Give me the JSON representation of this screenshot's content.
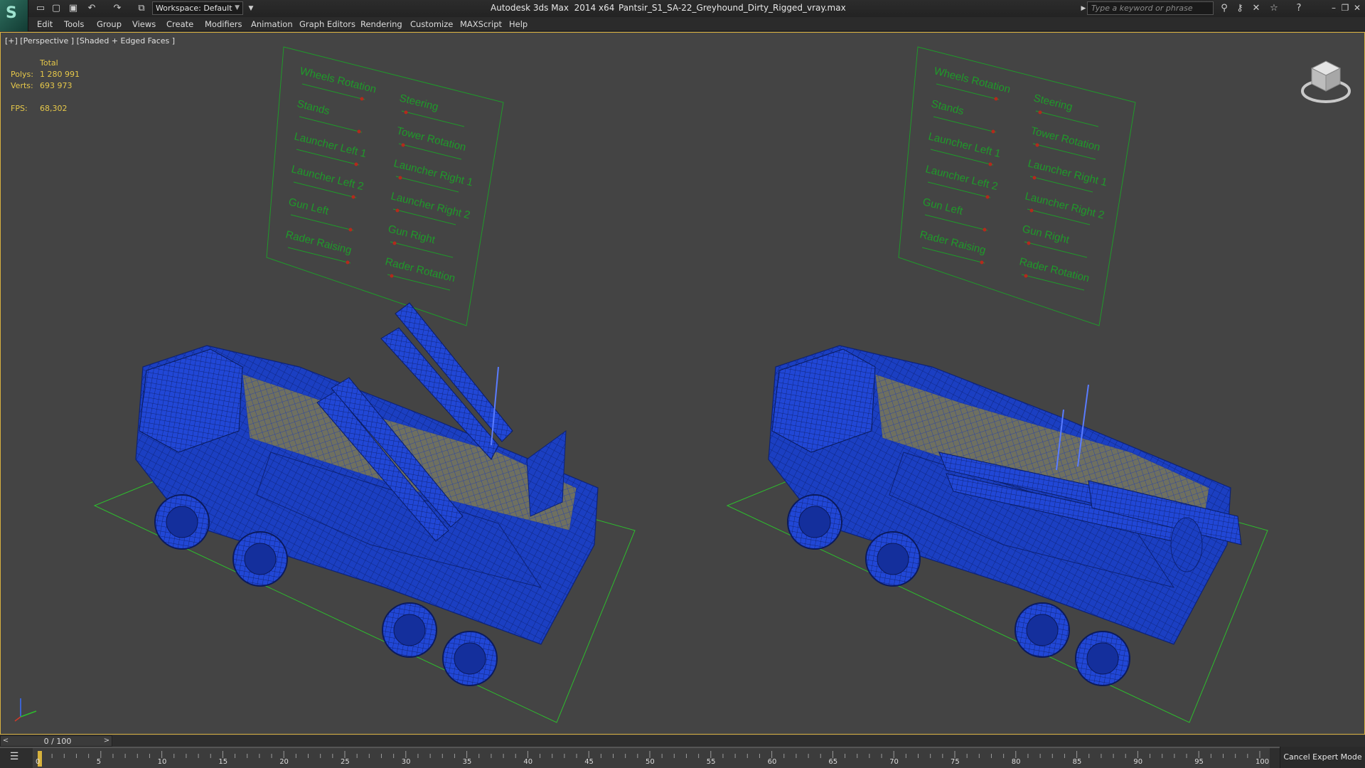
{
  "titlebar": {
    "app_title": "Autodesk 3ds Max  2014 x64",
    "file_name": "Pantsir_S1_SA-22_Greyhound_Dirty_Rigged_vray.max",
    "workspace_label": "Workspace: Default",
    "search_placeholder": "Type a keyword or phrase",
    "quick_access_icons": [
      "new-file-icon",
      "open-file-icon",
      "save-icon",
      "undo-icon",
      "redo-icon",
      "project-folder-icon"
    ],
    "help_icons": [
      "binoculars-icon",
      "key-icon",
      "tools-icon",
      "favorites-star-icon",
      "help-icon"
    ]
  },
  "menu": {
    "items": [
      {
        "label": "Edit"
      },
      {
        "label": "Tools"
      },
      {
        "label": "Group"
      },
      {
        "label": "Views"
      },
      {
        "label": "Create"
      },
      {
        "label": "Modifiers"
      },
      {
        "label": "Animation"
      },
      {
        "label": "Graph Editors"
      },
      {
        "label": "Rendering"
      },
      {
        "label": "Customize"
      },
      {
        "label": "MAXScript"
      },
      {
        "label": "Help"
      }
    ]
  },
  "viewport": {
    "label": "[+] [Perspective ] [Shaded + Edged Faces ]",
    "stats": {
      "header": "Total",
      "polys_label": "Polys:",
      "polys_value": "1 280 991",
      "verts_label": "Verts:",
      "verts_value": "693 973",
      "fps_label": "FPS:",
      "fps_value": "68,302"
    },
    "control_panels": [
      {
        "left_column": [
          "Wheels Rotation",
          "Stands",
          "Launcher Left 1",
          "Launcher Left 2",
          "Gun Left",
          "Rader Raising"
        ],
        "right_column": [
          "Steering",
          "Tower Rotation",
          "Launcher Right 1",
          "Launcher Right 2",
          "Gun Right",
          "Rader Rotation"
        ]
      },
      {
        "left_column": [
          "Wheels Rotation",
          "Stands",
          "Launcher Left 1",
          "Launcher Left 2",
          "Gun Left",
          "Rader Raising"
        ],
        "right_column": [
          "Steering",
          "Tower Rotation",
          "Launcher Right 1",
          "Launcher Right 2",
          "Gun Right",
          "Rader Rotation"
        ]
      }
    ],
    "colors": {
      "panel_green": "#1f9a2a",
      "slider_red": "#b42a1c",
      "mesh_blue": "#1b3fc2",
      "wire_green": "#2dbd2d",
      "stats_yellow": "#e6c84a"
    }
  },
  "timeline": {
    "slider_value": "0 / 100",
    "current_frame": 0,
    "total_frames": 100,
    "tick_labels": [
      "0",
      "5",
      "10",
      "15",
      "20",
      "25",
      "30",
      "35",
      "40",
      "45",
      "50",
      "55",
      "60",
      "65",
      "70",
      "75",
      "80",
      "85",
      "90",
      "95",
      "100"
    ],
    "cancel_expert_label": "Cancel Expert Mode"
  }
}
